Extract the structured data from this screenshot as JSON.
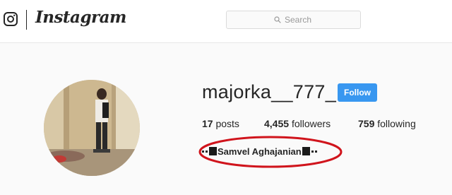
{
  "header": {
    "brand": "Instagram",
    "search_placeholder": "Search"
  },
  "profile": {
    "username": "majorka__777_",
    "follow_label": "Follow",
    "stats": {
      "posts_count": "17",
      "posts_label": "posts",
      "followers_count": "4,455",
      "followers_label": "followers",
      "following_count": "759",
      "following_label": "following"
    },
    "full_name": "Samvel Aghajanian"
  },
  "colors": {
    "follow_button": "#3897f0",
    "annotation_ellipse": "#d0141c"
  }
}
